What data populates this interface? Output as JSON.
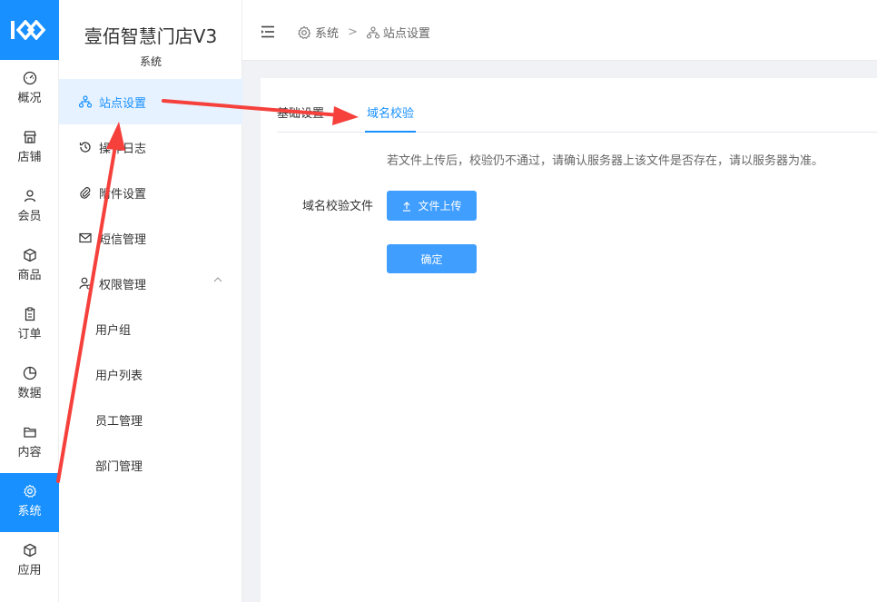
{
  "app": {
    "title": "壹佰智慧门店V3",
    "subtitle": "系统"
  },
  "rail": {
    "items": [
      {
        "label": "概况",
        "icon": "dashboard-icon"
      },
      {
        "label": "店铺",
        "icon": "store-icon"
      },
      {
        "label": "会员",
        "icon": "user-icon"
      },
      {
        "label": "商品",
        "icon": "box-icon"
      },
      {
        "label": "订单",
        "icon": "clipboard-icon"
      },
      {
        "label": "数据",
        "icon": "pie-chart-icon"
      },
      {
        "label": "内容",
        "icon": "folder-icon"
      },
      {
        "label": "系统",
        "icon": "gear-icon"
      },
      {
        "label": "应用",
        "icon": "cube-icon"
      }
    ],
    "active": "系统"
  },
  "subnav": {
    "items": [
      {
        "label": "站点设置",
        "icon": "sitemap-icon"
      },
      {
        "label": "操作日志",
        "icon": "history-icon"
      },
      {
        "label": "附件设置",
        "icon": "paperclip-icon"
      },
      {
        "label": "短信管理",
        "icon": "mail-icon"
      },
      {
        "label": "权限管理",
        "icon": "user-permission-icon"
      }
    ],
    "children": [
      {
        "label": "用户组"
      },
      {
        "label": "用户列表"
      },
      {
        "label": "员工管理"
      },
      {
        "label": "部门管理"
      }
    ],
    "active": "站点设置"
  },
  "breadcrumb": {
    "items": [
      "系统",
      "站点设置"
    ],
    "separator": ">"
  },
  "tabs": [
    {
      "label": "基础设置"
    },
    {
      "label": "域名校验"
    }
  ],
  "active_tab": "域名校验",
  "form": {
    "hint": "若文件上传后，校验仍不通过，请确认服务器上该文件是否存在，请以服务器为准。",
    "file_label": "域名校验文件",
    "upload_label": "文件上传",
    "confirm_label": "确定"
  },
  "colors": {
    "primary": "#1890ff",
    "button": "#409eff",
    "annotation": "#f5403c"
  }
}
